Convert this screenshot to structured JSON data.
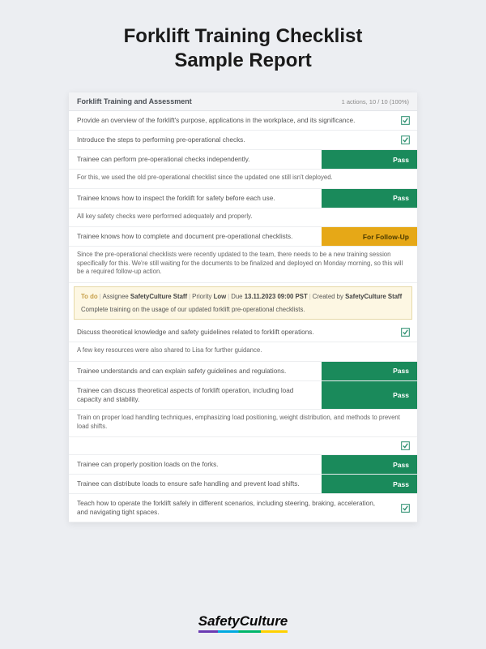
{
  "title_line1": "Forklift Training Checklist",
  "title_line2": "Sample Report",
  "header": {
    "title": "Forklift Training and Assessment",
    "meta": "1 actions, 10 / 10 (100%)"
  },
  "rows": [
    {
      "type": "check",
      "text": "Provide an overview of the forklift's purpose, applications in the workplace, and its significance."
    },
    {
      "type": "check",
      "text": "Introduce the steps to performing pre-operational checks."
    },
    {
      "type": "badge",
      "text": "Trainee can perform pre-operational checks independently.",
      "badge": "Pass",
      "badgeClass": "badge-pass"
    },
    {
      "type": "note",
      "text": "For this, we used the old pre-operational checklist since the updated one still isn't deployed."
    },
    {
      "type": "badge",
      "text": "Trainee knows how to inspect the forklift for safety before each use.",
      "badge": "Pass",
      "badgeClass": "badge-pass"
    },
    {
      "type": "note",
      "text": "All key safety checks were performed adequately and properly."
    },
    {
      "type": "badge",
      "text": "Trainee knows how to complete and document pre-operational checklists.",
      "badge": "For Follow-Up",
      "badgeClass": "badge-follow"
    },
    {
      "type": "note",
      "text": "Since the pre-operational checklists were recently updated to the team, there needs to be a new training session specifically for this. We're still waiting for the documents to be finalized and deployed on Monday morning, so this will be a required follow-up action."
    },
    {
      "type": "todo"
    },
    {
      "type": "check",
      "text": "Discuss theoretical knowledge and safety guidelines related to forklift operations."
    },
    {
      "type": "note",
      "text": "A few key resources were also shared to Lisa for further guidance."
    },
    {
      "type": "badge",
      "text": "Trainee understands and can explain safety guidelines and regulations.",
      "badge": "Pass",
      "badgeClass": "badge-pass"
    },
    {
      "type": "badge",
      "text": "Trainee can discuss theoretical aspects of forklift operation, including load capacity and stability.",
      "badge": "Pass",
      "badgeClass": "badge-pass"
    },
    {
      "type": "plain",
      "text": "Train on proper load handling techniques, emphasizing load positioning, weight distribution, and methods to prevent load shifts."
    },
    {
      "type": "check",
      "text": ""
    },
    {
      "type": "badge",
      "text": "Trainee can properly position loads on the forks.",
      "badge": "Pass",
      "badgeClass": "badge-pass"
    },
    {
      "type": "badge",
      "text": "Trainee can distribute loads to ensure safe handling and prevent load shifts.",
      "badge": "Pass",
      "badgeClass": "badge-pass"
    },
    {
      "type": "check",
      "text": "Teach how to operate the forklift safely in different scenarios, including steering, braking, acceleration, and navigating tight spaces."
    }
  ],
  "todo": {
    "label": "To do",
    "assignee_label": "Assignee",
    "assignee": "SafetyCulture Staff",
    "priority_label": "Priority",
    "priority": "Low",
    "due_label": "Due",
    "due": "13.11.2023 09:00 PST",
    "created_label": "Created by",
    "created_by": "SafetyCulture Staff",
    "body": "Complete training on the usage of our updated forklift pre-operational checklists."
  },
  "brand": "SafetyCulture"
}
